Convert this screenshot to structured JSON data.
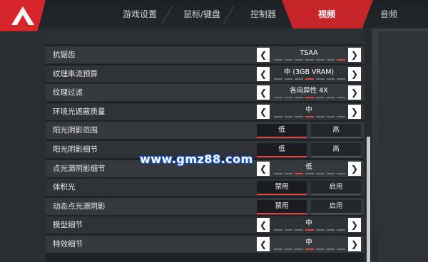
{
  "tabs": [
    {
      "label": "游戏设置"
    },
    {
      "label": "鼠标/键盘"
    },
    {
      "label": "控制器"
    },
    {
      "label": "视频"
    },
    {
      "label": "音频"
    }
  ],
  "settings": [
    {
      "label": "抗锯齿",
      "type": "stepper",
      "value": "TSAA",
      "level": 1.0
    },
    {
      "label": "纹理串流预算",
      "type": "stepper",
      "value": "中 (3GB VRAM)",
      "level": 0.57
    },
    {
      "label": "纹理过滤",
      "type": "stepper",
      "value": "各向异性 4X",
      "level": 0.43
    },
    {
      "label": "环境光遮蔽质量",
      "type": "stepper",
      "value": "中",
      "level": 0.5
    },
    {
      "label": "阳光阴影范围",
      "type": "toggle",
      "options": [
        "低",
        "高"
      ],
      "selected": 0
    },
    {
      "label": "阳光阴影细节",
      "type": "toggle",
      "options": [
        "低",
        "高"
      ],
      "selected": 0
    },
    {
      "label": "点光源阴影细节",
      "type": "stepper",
      "value": "低",
      "level": 0.25
    },
    {
      "label": "体积光",
      "type": "toggle",
      "options": [
        "禁用",
        "启用"
      ],
      "selected": 0
    },
    {
      "label": "动态点光源阴影",
      "type": "toggle",
      "options": [
        "禁用",
        "启用"
      ],
      "selected": 0
    },
    {
      "label": "模型细节",
      "type": "stepper",
      "value": "中",
      "level": 0.5
    },
    {
      "label": "特效细节",
      "type": "stepper",
      "value": "中",
      "level": 0.5
    }
  ],
  "watermark": "www.gmz88.com",
  "colors": {
    "accent": "#c6252a",
    "tick_active": "#d9483a"
  }
}
